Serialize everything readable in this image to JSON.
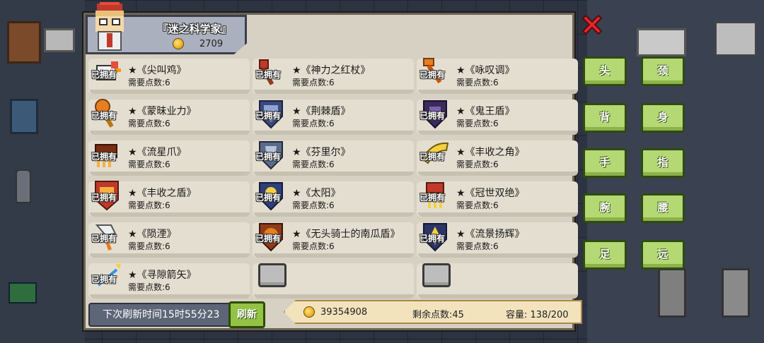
{
  "header": {
    "title": "『迷之科学家』",
    "coins": "2709"
  },
  "items": [
    {
      "name": "★《尖叫鸡》",
      "cost": "需要点数:6",
      "owned": "已拥有",
      "icon": "chicken-icon"
    },
    {
      "name": "★《神力之红杖》",
      "cost": "需要点数:6",
      "owned": "已拥有",
      "icon": "red-staff-icon"
    },
    {
      "name": "★《咏叹调》",
      "cost": "需要点数:6",
      "owned": "已拥有",
      "icon": "aria-staff-icon"
    },
    {
      "name": "★《蒙昧业力》",
      "cost": "需要点数:6",
      "owned": "已拥有",
      "icon": "karma-staff-icon"
    },
    {
      "name": "★《荆棘盾》",
      "cost": "需要点数:6",
      "owned": "已拥有",
      "icon": "thorn-shield-icon"
    },
    {
      "name": "★《鬼王盾》",
      "cost": "需要点数:6",
      "owned": "已拥有",
      "icon": "ghost-shield-icon"
    },
    {
      "name": "★《流星爪》",
      "cost": "需要点数:6",
      "owned": "已拥有",
      "icon": "meteor-claw-icon"
    },
    {
      "name": "★《芬里尔》",
      "cost": "需要点数:6",
      "owned": "已拥有",
      "icon": "fenrir-icon"
    },
    {
      "name": "★《丰收之角》",
      "cost": "需要点数:6",
      "owned": "已拥有",
      "icon": "horn-icon"
    },
    {
      "name": "★《丰收之盾》",
      "cost": "需要点数:6",
      "owned": "已拥有",
      "icon": "harvest-shield-icon"
    },
    {
      "name": "★《太阳》",
      "cost": "需要点数:6",
      "owned": "已拥有",
      "icon": "sun-shield-icon"
    },
    {
      "name": "★《冠世双绝》",
      "cost": "需要点数:6",
      "owned": "已拥有",
      "icon": "twin-blades-icon"
    },
    {
      "name": "★《陨湮》",
      "cost": "需要点数:6",
      "owned": "已拥有",
      "icon": "meteor-axe-icon"
    },
    {
      "name": "★《无头骑士的南瓜盾》",
      "cost": "需要点数:6",
      "owned": "已拥有",
      "icon": "pumpkin-shield-icon"
    },
    {
      "name": "★《流景扬辉》",
      "cost": "需要点数:6",
      "owned": "已拥有",
      "icon": "radiant-shield-icon"
    },
    {
      "name": "★《寻隙箭矢》",
      "cost": "需要点数:6",
      "owned": "已拥有",
      "icon": "arrow-icon"
    }
  ],
  "footer": {
    "refresh_time": "下次刷新时间15时55分23",
    "refresh_label": "刷新",
    "total_coins": "39354908",
    "remaining_points": "剩余点数:45",
    "capacity": "容量: 138/200"
  },
  "side_buttons": [
    "头",
    "颈",
    "背",
    "身",
    "手",
    "指",
    "腕",
    "腰",
    "足",
    "远"
  ],
  "colors": {
    "panel": "#d7d1c3",
    "button_green": "#b4d873",
    "close_red": "#e0282e",
    "coin_gold": "#e6a816"
  }
}
